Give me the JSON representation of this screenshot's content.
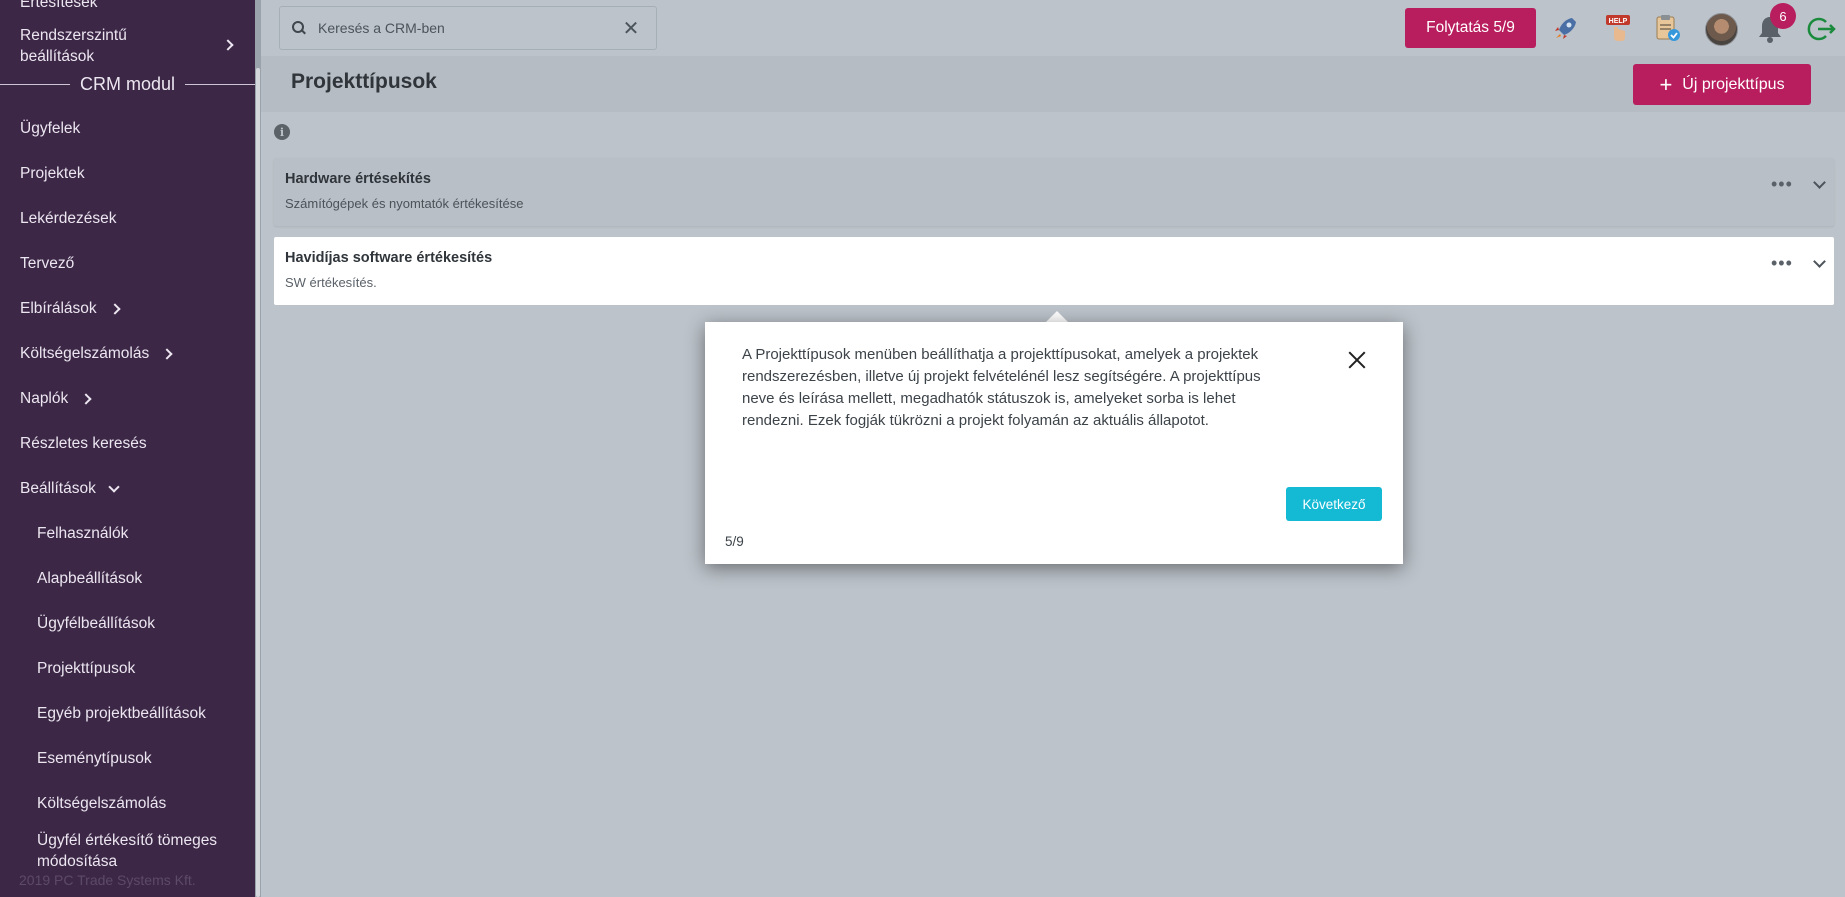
{
  "sidebar": {
    "top_items": {
      "notifications": "Értesítések",
      "system_settings": "Rendszerszintű",
      "system_settings_2": "beállítások"
    },
    "section_title": "CRM modul",
    "items": {
      "clients": "Ügyfelek",
      "projects": "Projektek",
      "queries": "Lekérdezések",
      "planner": "Tervező",
      "evaluations": "Elbírálások",
      "expenses": "Költségelszámolás",
      "logs": "Naplók",
      "detailed_search": "Részletes keresés",
      "settings": "Beállítások"
    },
    "sub_items": {
      "users": "Felhasználók",
      "basic_settings": "Alapbeállítások",
      "client_settings": "Ügyfélbeállítások",
      "project_types": "Projekttípusok",
      "other_project_settings": "Egyéb projektbeállítások",
      "event_types": "Eseménytípusok",
      "expense_settlement": "Költségelszámolás",
      "client_rating_bulk": "Ügyfél értékesítő tömeges",
      "client_rating_bulk_2": "módosítása"
    },
    "copyright": "2019 PC Trade Systems Kft."
  },
  "topbar": {
    "search_placeholder": "Keresés a CRM-ben",
    "continue_label": "Folytatás 5/9",
    "notification_count": "6",
    "help_label": "HELP",
    "icons": [
      "rocket-icon",
      "help-icon",
      "clipboard-icon",
      "avatar",
      "bell-icon",
      "logout-icon"
    ]
  },
  "page": {
    "title": "Projekttípusok",
    "new_button": "Új projekttípus",
    "cards": [
      {
        "title": "Hardware értésekítés",
        "description": "Számítógépek és nyomtatók értékesítése"
      },
      {
        "title": "Havidíjas software értékesítés",
        "description": "SW értékesítés."
      }
    ]
  },
  "tour": {
    "text": "A Projekttípusok menüben beállíthatja a projekttípusokat, amelyek a projektek rendszerezésben, illetve új projekt felvételénél lesz segítségére. A projekttípus neve és leírása mellett, megadhatók státuszok is, amelyeket sorba is lehet rendezni. Ezek fogják tükrözni a projekt folyamán az aktuális állapotot.",
    "next_label": "Következő",
    "step": "5/9"
  },
  "colors": {
    "sidebar_bg": "#3c2747",
    "accent_pink": "#b81d5d",
    "accent_cyan": "#14b9d4",
    "overlay_bg": "#bcc3ca"
  }
}
